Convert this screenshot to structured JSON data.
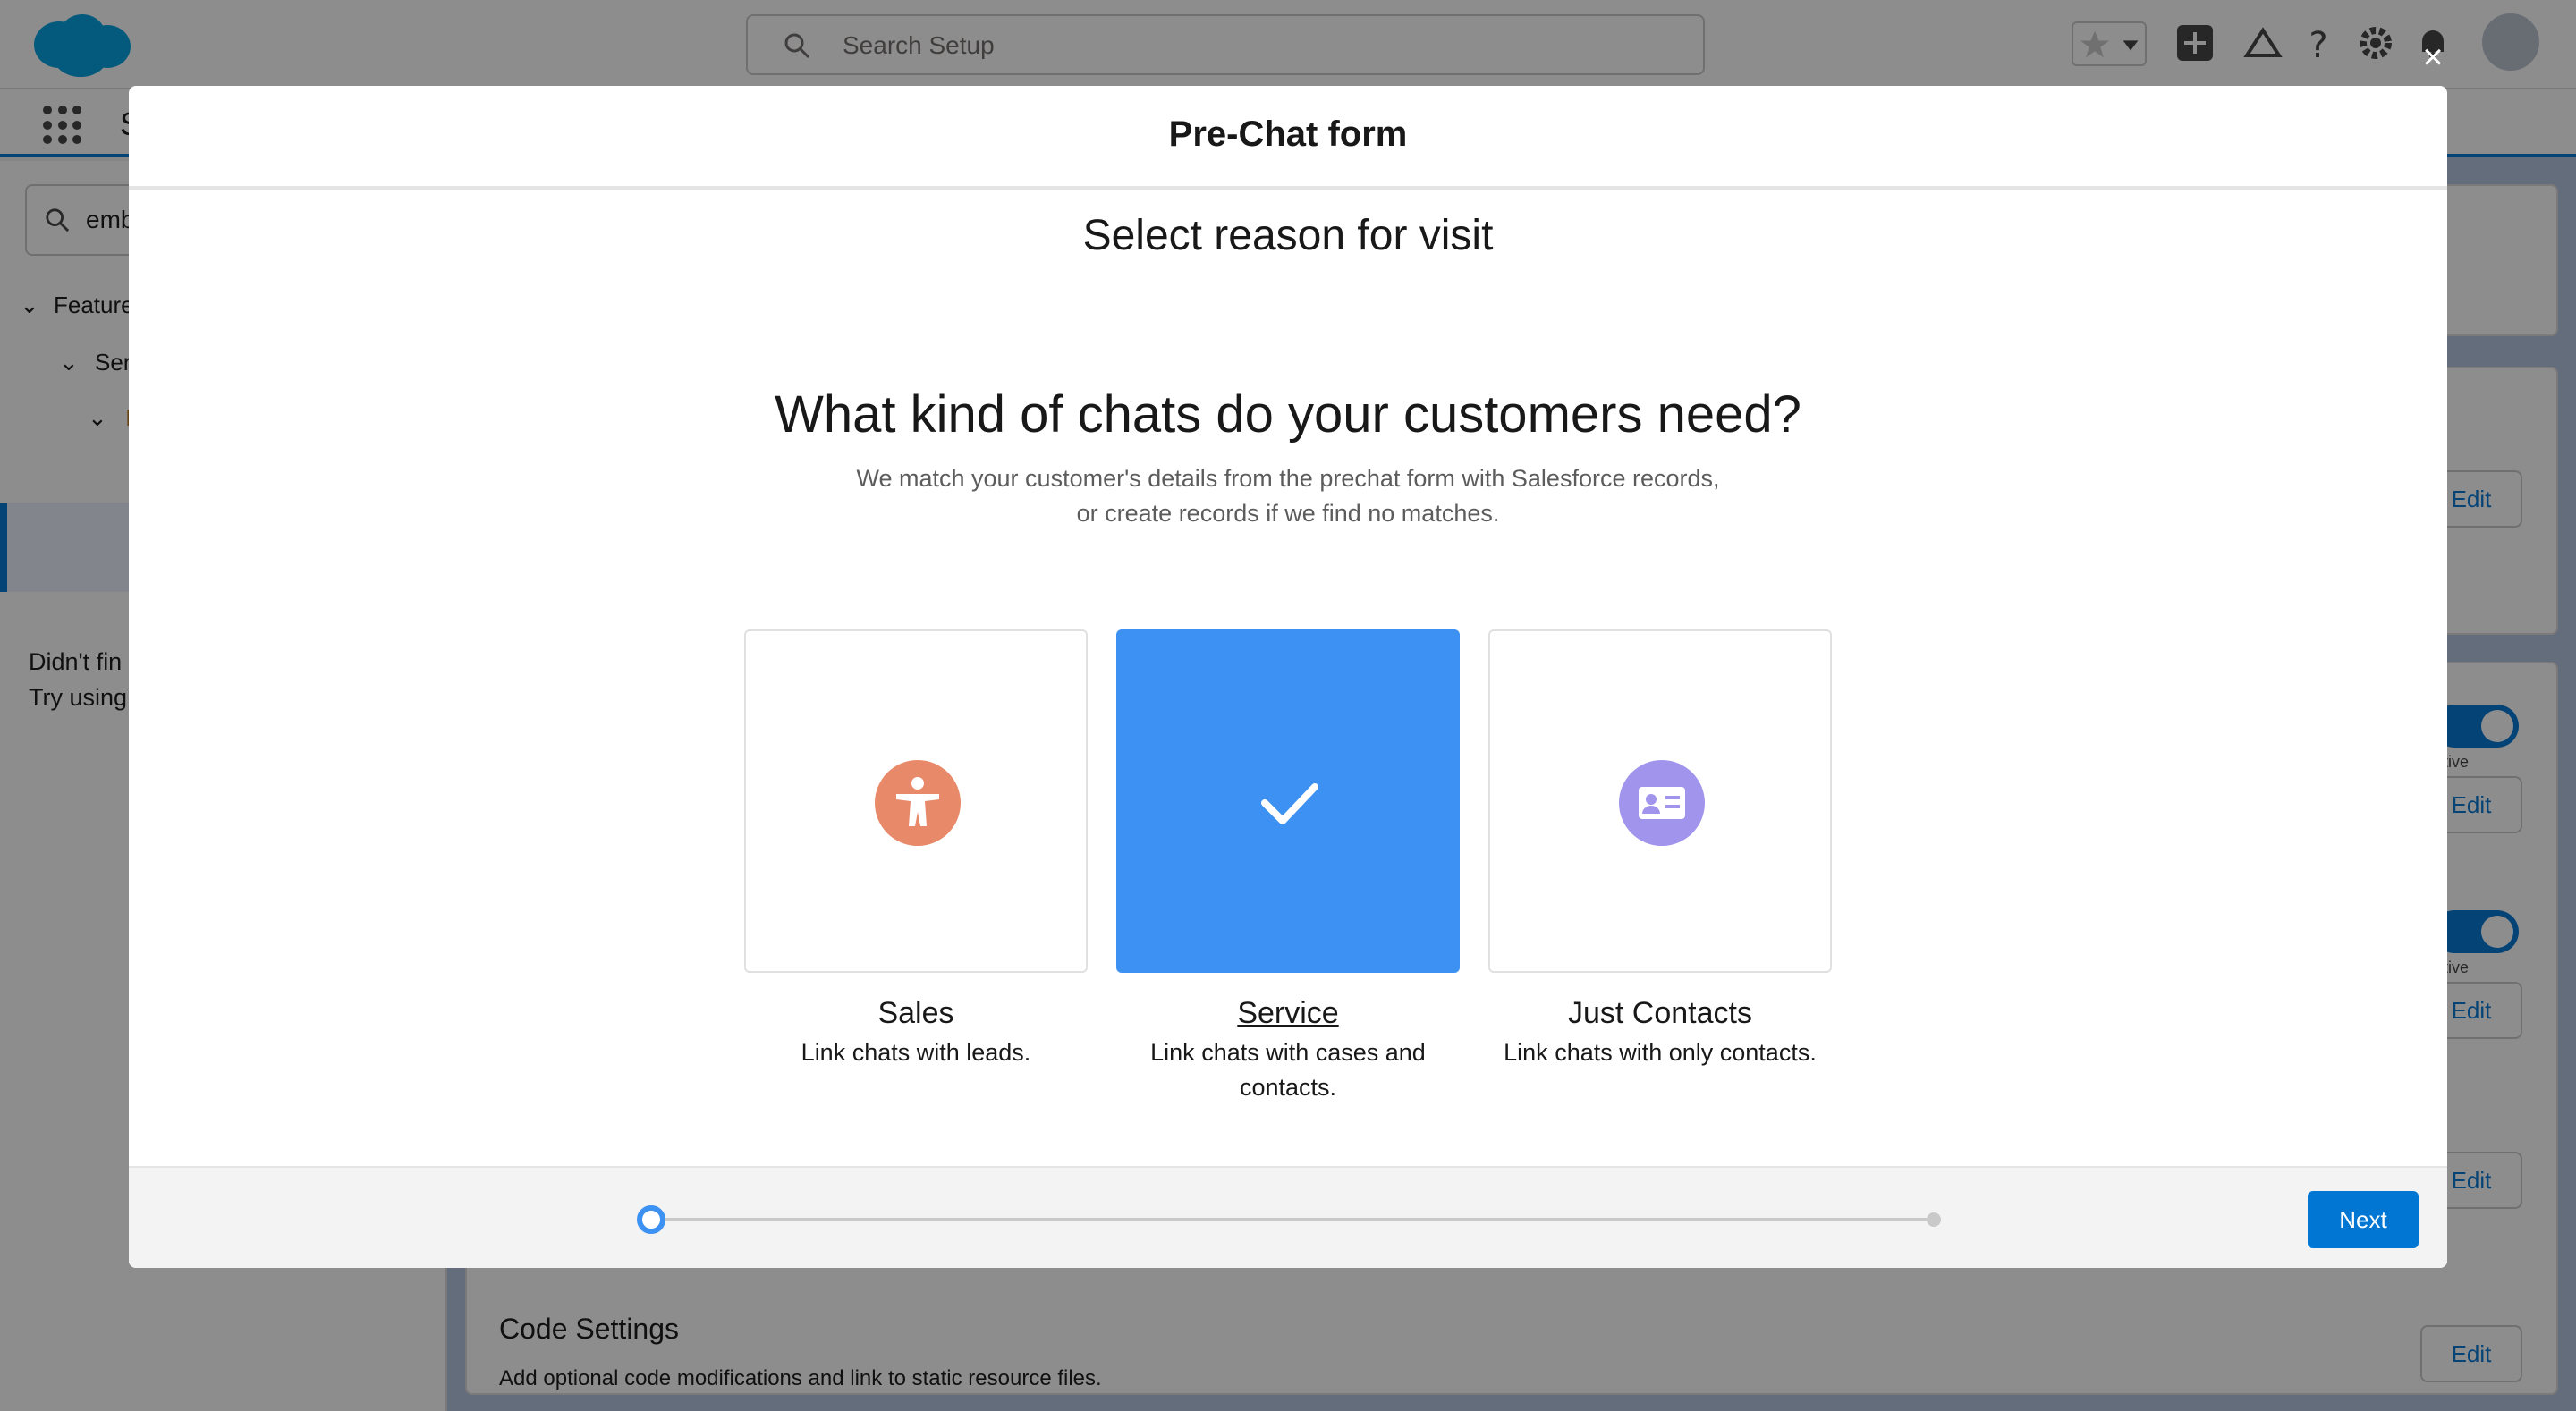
{
  "header": {
    "search_placeholder": "Search Setup",
    "icons": [
      "favorites-star-icon",
      "dropdown-chevron-icon",
      "add-icon",
      "trailhead-icon",
      "help-icon",
      "setup-gear-icon",
      "notifications-bell-icon",
      "user-avatar"
    ]
  },
  "nav": {
    "title": "S"
  },
  "sidebar": {
    "search_value": "emb",
    "tree": [
      "Feature",
      "Ser",
      "I"
    ],
    "note_line1": "Didn't fin",
    "note_line2": "Try using"
  },
  "background": {
    "edit_label": "Edit",
    "active_label": "tive",
    "code_settings_title": "Code Settings",
    "code_settings_desc": "Add optional code modifications and link to static resource files."
  },
  "modal": {
    "title": "Pre-Chat form",
    "step_title": "Select reason for visit",
    "question": "What kind of chats do your customers need?",
    "description_line1": "We match your customer's details from the prechat form with Salesforce records,",
    "description_line2": "or create records if we find no matches.",
    "options": [
      {
        "label": "Sales",
        "description": "Link chats with leads.",
        "icon": "person-icon",
        "selected": false,
        "icon_color": "#e8896a"
      },
      {
        "label": "Service",
        "description": "Link chats with cases and contacts.",
        "icon": "checkmark-icon",
        "selected": true,
        "tile_color": "#3c91f3"
      },
      {
        "label": "Just Contacts",
        "description": "Link chats with only contacts.",
        "icon": "contact-card-icon",
        "selected": false,
        "icon_color": "#a094ed"
      }
    ],
    "progress": {
      "current_step": 1,
      "total_steps": 2
    },
    "next_label": "Next",
    "close_label": "×"
  },
  "colors": {
    "brand": "#0176d3",
    "accent_blue": "#3c91f3"
  }
}
